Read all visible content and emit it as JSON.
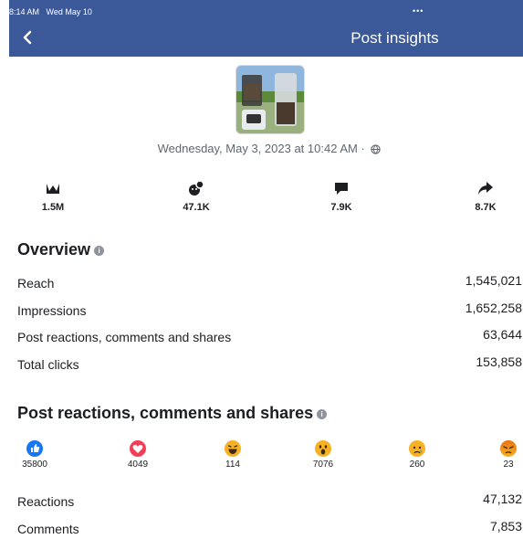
{
  "status": {
    "time": "8:14 AM",
    "date": "Wed May 10",
    "dots": "•••"
  },
  "nav": {
    "title": "Post insights",
    "back_icon": "chevron-left-icon"
  },
  "post": {
    "date": "Wednesday, May 3, 2023 at 10:42 AM ·",
    "privacy_icon": "globe-icon"
  },
  "stats": [
    {
      "icon": "reach-icon",
      "value": "1.5M"
    },
    {
      "icon": "reactions-icon",
      "value": "47.1K"
    },
    {
      "icon": "comment-icon",
      "value": "7.9K"
    },
    {
      "icon": "share-icon",
      "value": "8.7K"
    }
  ],
  "overview": {
    "title": "Overview",
    "rows": [
      {
        "label": "Reach",
        "value": "1,545,021"
      },
      {
        "label": "Impressions",
        "value": "1,652,258"
      },
      {
        "label": "Post reactions, comments and shares",
        "value": "63,644"
      },
      {
        "label": "Total clicks",
        "value": "153,858"
      }
    ]
  },
  "engagement": {
    "title": "Post reactions, comments and shares",
    "reactions": [
      {
        "icon": "like-icon",
        "count": "35800",
        "color": "#1877f2"
      },
      {
        "icon": "love-icon",
        "count": "4049",
        "color": "#f33e58"
      },
      {
        "icon": "haha-icon",
        "count": "114",
        "color": "#f7b125"
      },
      {
        "icon": "wow-icon",
        "count": "7076",
        "color": "#f7b125"
      },
      {
        "icon": "sad-icon",
        "count": "260",
        "color": "#f7b125"
      },
      {
        "icon": "angry-icon",
        "count": "23",
        "color": "#e9710f"
      }
    ],
    "rows": [
      {
        "label": "Reactions",
        "value": "47,132"
      },
      {
        "label": "Comments",
        "value": "7,853"
      }
    ]
  }
}
